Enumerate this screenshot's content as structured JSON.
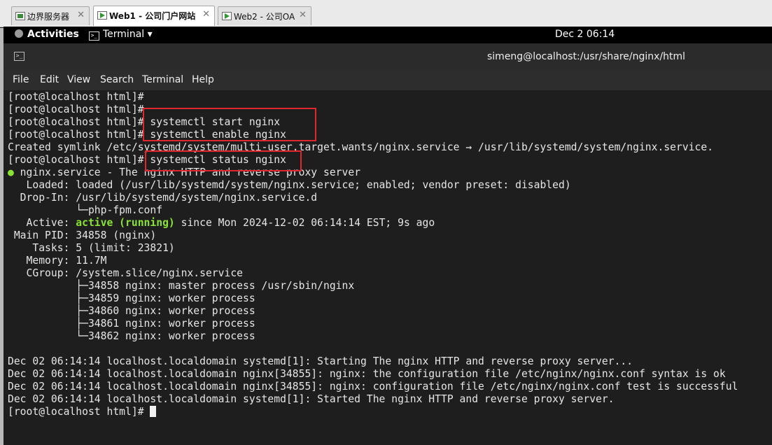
{
  "vm_tabs": [
    {
      "label": "边界服务器",
      "close": "✕"
    },
    {
      "label": "Web1 - 公司门户网站",
      "close": "✕"
    },
    {
      "label": "Web2 - 公司OA",
      "close": "✕"
    }
  ],
  "top_bar": {
    "activities": "Activities",
    "app_menu": "Terminal",
    "app_menu_arrow": "▾",
    "clock": "Dec 2  06:14"
  },
  "terminal": {
    "title": "simeng@localhost:/usr/share/nginx/html",
    "menu": [
      "File",
      "Edit",
      "View",
      "Search",
      "Terminal",
      "Help"
    ],
    "prompt": "[root@localhost html]# ",
    "lines": [
      "[root@localhost html]#",
      "[root@localhost html]#",
      "[root@localhost html]# systemctl start nginx",
      "[root@localhost html]# systemctl enable nginx",
      "Created symlink /etc/systemd/system/multi-user.target.wants/nginx.service → /usr/lib/systemd/system/nginx.service.",
      "[root@localhost html]# systemctl status nginx",
      " nginx.service - The nginx HTTP and reverse proxy server",
      "   Loaded: loaded (/usr/lib/systemd/system/nginx.service; enabled; vendor preset: disabled)",
      "  Drop-In: /usr/lib/systemd/system/nginx.service.d",
      "           └─php-fpm.conf",
      "   Active: ",
      " Main PID: 34858 (nginx)",
      "    Tasks: 5 (limit: 23821)",
      "   Memory: 11.7M",
      "   CGroup: /system.slice/nginx.service",
      "           ├─34858 nginx: master process /usr/sbin/nginx",
      "           ├─34859 nginx: worker process",
      "           ├─34860 nginx: worker process",
      "           ├─34861 nginx: worker process",
      "           └─34862 nginx: worker process",
      "",
      "Dec 02 06:14:14 localhost.localdomain systemd[1]: Starting The nginx HTTP and reverse proxy server...",
      "Dec 02 06:14:14 localhost.localdomain nginx[34855]: nginx: the configuration file /etc/nginx/nginx.conf syntax is ok",
      "Dec 02 06:14:14 localhost.localdomain nginx[34855]: nginx: configuration file /etc/nginx/nginx.conf test is successful",
      "Dec 02 06:14:14 localhost.localdomain systemd[1]: Started The nginx HTTP and reverse proxy server."
    ],
    "status_dot": "●",
    "active_state": "active (running)",
    "active_since": " since Mon 2024-12-02 06:14:14 EST; 9s ago"
  },
  "colors": {
    "active_green": "#8ae234",
    "highlight_red": "#e0262e"
  }
}
